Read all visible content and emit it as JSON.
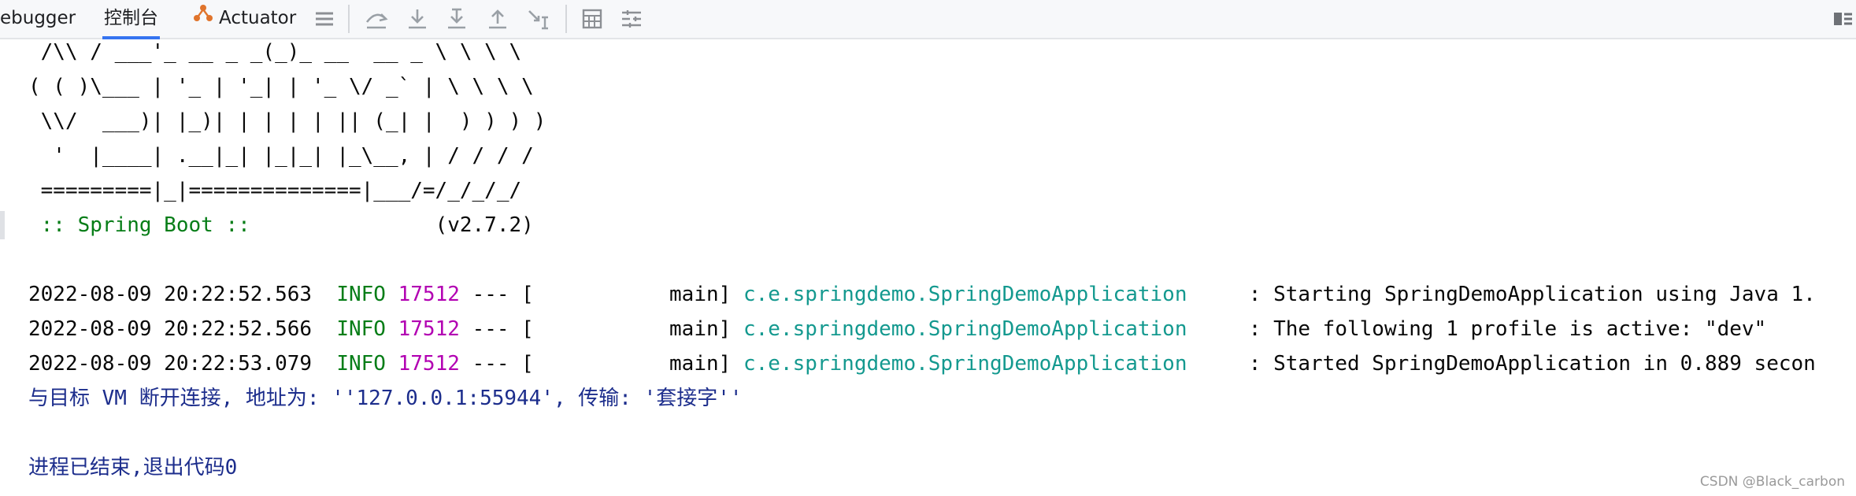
{
  "toolbar": {
    "tabs": [
      {
        "label": "ebugger"
      },
      {
        "label": "控制台"
      },
      {
        "label": "Actuator"
      }
    ],
    "icons": [
      "menu-icon",
      "step-over-icon",
      "step-into-icon",
      "force-step-into-icon",
      "step-out-icon",
      "run-to-cursor-icon",
      "evaluate-icon",
      "trace-icon",
      "layout-icon"
    ]
  },
  "console": {
    "banner": [
      " /\\\\ / ___'_ __ _ _(_)_ __  __ _ \\ \\ \\ \\",
      "( ( )\\___ | '_ | '_| | '_ \\/ _` | \\ \\ \\ \\",
      " \\\\/  ___)| |_)| | | | | || (_| |  ) ) ) )",
      "  '  |____| .__|_| |_|_| |_\\__, | / / / /",
      " =========|_|==============|___/=/_/_/_/"
    ],
    "spring_boot_label": " :: Spring Boot :: ",
    "spring_boot_version": "              (v2.7.2)",
    "logs": [
      {
        "timestamp": "2022-08-09 20:22:52.563",
        "level": "INFO",
        "pid": "17512",
        "sep": "--- [",
        "thread": "           main]",
        "logger": "c.e.springdemo.SpringDemoApplication",
        "message": ": Starting SpringDemoApplication using Java 1."
      },
      {
        "timestamp": "2022-08-09 20:22:52.566",
        "level": "INFO",
        "pid": "17512",
        "sep": "--- [",
        "thread": "           main]",
        "logger": "c.e.springdemo.SpringDemoApplication",
        "message": ": The following 1 profile is active: \"dev\""
      },
      {
        "timestamp": "2022-08-09 20:22:53.079",
        "level": "INFO",
        "pid": "17512",
        "sep": "--- [",
        "thread": "           main]",
        "logger": "c.e.springdemo.SpringDemoApplication",
        "message": ": Started SpringDemoApplication in 0.889 secon"
      }
    ],
    "disconnect_message": "与目标 VM 断开连接, 地址为: ''127.0.0.1:55944', 传输: '套接字''",
    "exit_message": "进程已结束,退出代码0"
  },
  "watermark": "CSDN @Black_carbon",
  "colors": {
    "green": "#067d17",
    "pid": "#b200b2",
    "logger": "#14998f",
    "system": "#1c2d8c",
    "active_tab": "#3574f0"
  }
}
